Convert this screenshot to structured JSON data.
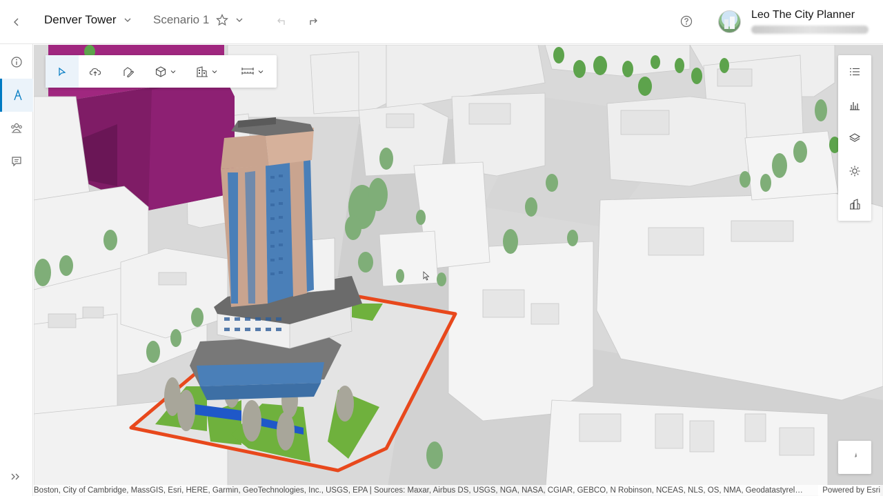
{
  "header": {
    "project_title": "Denver Tower",
    "scenario_title": "Scenario 1",
    "user_name": "Leo The City Planner"
  },
  "attribution": {
    "sources": "Boston, City of Cambridge, MassGIS, Esri, HERE, Garmin, GeoTechnologies, Inc., USGS, EPA | Sources: Maxar, Airbus DS, USGS, NGA, NASA, CGIAR, GEBCO, N Robinson, NCEAS, NLS, OS, NMA, Geodatastyrel…",
    "powered_by": "Powered by Esri"
  },
  "left_rail": {
    "active_item": "design"
  },
  "colors": {
    "accent": "#007ac2",
    "site_boundary": "#e8481c",
    "highlight_building": "#8a1e6f",
    "tower_facade": "#c9a48f",
    "tower_glass": "#4a7fb8",
    "green_space": "#6fb13d",
    "water_feature": "#1f58c8"
  }
}
